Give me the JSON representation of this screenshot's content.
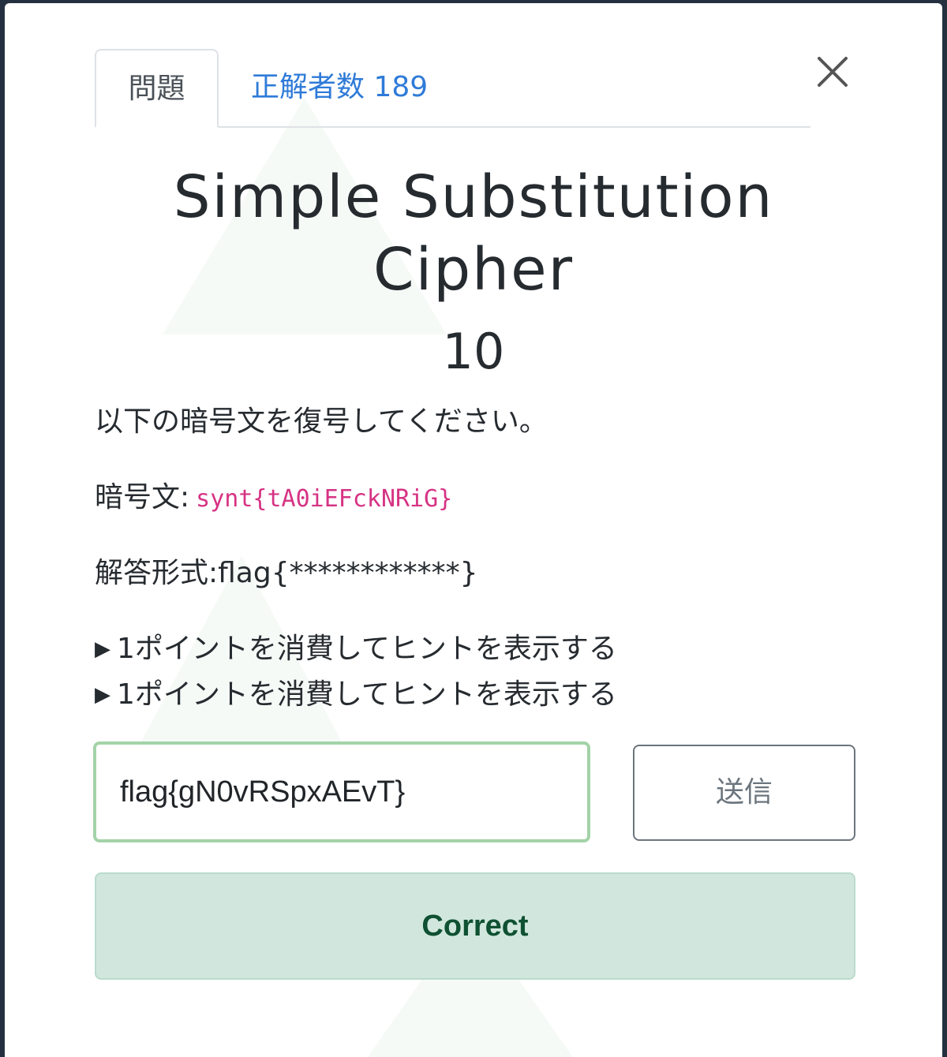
{
  "tabs": {
    "problem_label": "問題",
    "solves_label": "正解者数 189"
  },
  "challenge": {
    "title": "Simple Substitution Cipher",
    "points": "10",
    "description": "以下の暗号文を復号してください。",
    "ciphertext_label": "暗号文:",
    "ciphertext": "synt{tA0iEFckNRiG}",
    "answer_format": "解答形式:flag{************}"
  },
  "hints": [
    {
      "label": "1ポイントを消費してヒントを表示する"
    },
    {
      "label": "1ポイントを消費してヒントを表示する"
    }
  ],
  "form": {
    "flag_value": "flag{gN0vRSpxAEvT}",
    "submit_label": "送信"
  },
  "result": {
    "message": "Correct"
  },
  "colors": {
    "tab_link": "#2f7bd8",
    "code": "#d63384",
    "input_border": "#a3d3a8",
    "success_bg": "#d1e7dd",
    "success_text": "#0f5132"
  }
}
